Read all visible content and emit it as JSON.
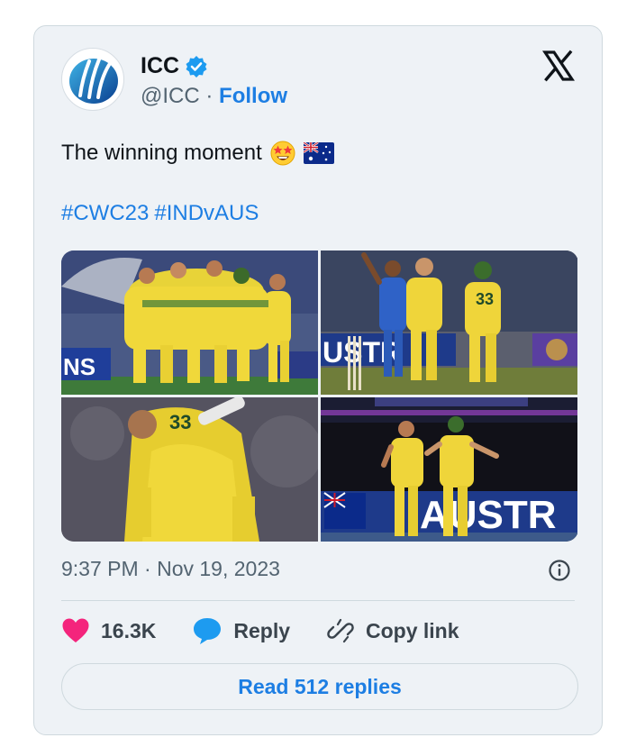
{
  "account": {
    "name": "ICC",
    "handle": "@ICC",
    "separator": "·",
    "follow_label": "Follow",
    "verified": true
  },
  "tweet": {
    "text": "The winning moment",
    "emoji": [
      "star-struck-emoji",
      "australia-flag-emoji"
    ],
    "hashtags": [
      "#CWC23",
      "#INDvAUS"
    ],
    "timestamp": "9:37 PM · Nov 19, 2023"
  },
  "media": {
    "photos": [
      {
        "name": "team-celebration-photo"
      },
      {
        "name": "players-celebrating-on-field-photo"
      },
      {
        "name": "players-embrace-photo"
      },
      {
        "name": "players-running-photo"
      }
    ],
    "banner_texts": [
      "NS",
      "USTR",
      "AUSTR"
    ]
  },
  "engagement": {
    "likes": "16.3K",
    "reply_label": "Reply",
    "copy_link_label": "Copy link"
  },
  "footer": {
    "read_replies_label": "Read 512 replies"
  },
  "colors": {
    "link": "#1d7ee3",
    "like": "#f4247c",
    "reply_bubble": "#1d9bf0",
    "card_bg": "#eef2f6"
  }
}
